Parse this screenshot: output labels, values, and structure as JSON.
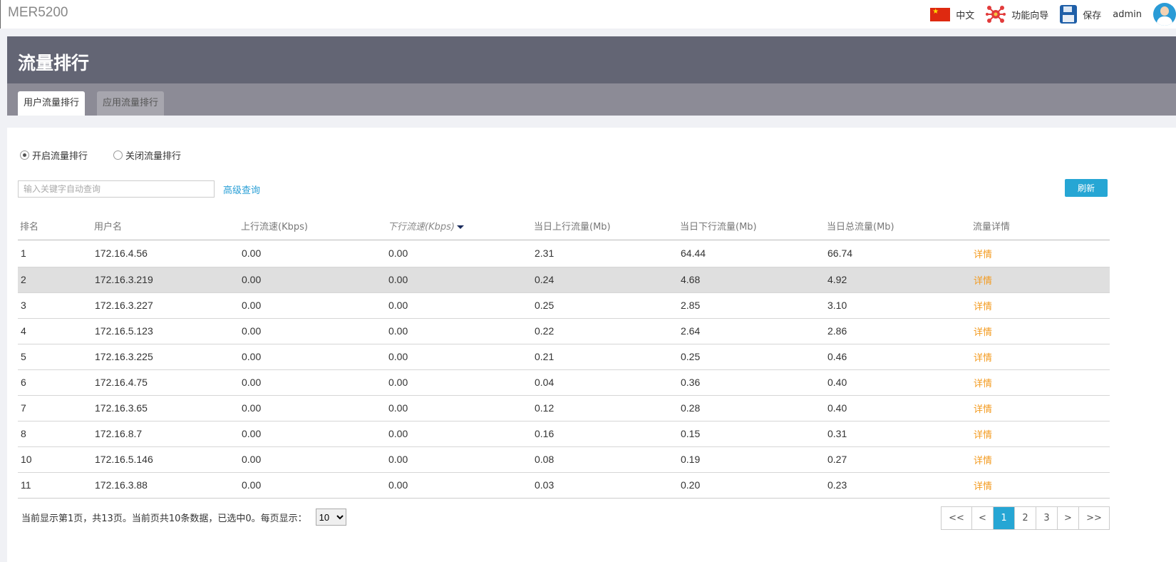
{
  "app": {
    "brand": "MER5200"
  },
  "topnav": {
    "language": "中文",
    "wizard": "功能向导",
    "save": "保存",
    "user": "admin"
  },
  "page": {
    "title": "流量排行",
    "tabs": [
      {
        "label": "用户流量排行",
        "active": true
      },
      {
        "label": "应用流量排行",
        "active": false
      }
    ]
  },
  "controls": {
    "radio_on": "开启流量排行",
    "radio_off": "关闭流量排行",
    "search_placeholder": "输入关键字自动查询",
    "advanced": "高级查询",
    "refresh": "刷新"
  },
  "table": {
    "headers": [
      "排名",
      "用户名",
      "上行流速(Kbps)",
      "下行流速(Kbps)",
      "当日上行流量(Mb)",
      "当日下行流量(Mb)",
      "当日总流量(Mb)",
      "流量详情"
    ],
    "detail_label": "详情",
    "rows": [
      [
        "1",
        "172.16.4.56",
        "0.00",
        "0.00",
        "2.31",
        "64.44",
        "66.74"
      ],
      [
        "2",
        "172.16.3.219",
        "0.00",
        "0.00",
        "0.24",
        "4.68",
        "4.92"
      ],
      [
        "3",
        "172.16.3.227",
        "0.00",
        "0.00",
        "0.25",
        "2.85",
        "3.10"
      ],
      [
        "4",
        "172.16.5.123",
        "0.00",
        "0.00",
        "0.22",
        "2.64",
        "2.86"
      ],
      [
        "5",
        "172.16.3.225",
        "0.00",
        "0.00",
        "0.21",
        "0.25",
        "0.46"
      ],
      [
        "6",
        "172.16.4.75",
        "0.00",
        "0.00",
        "0.04",
        "0.36",
        "0.40"
      ],
      [
        "7",
        "172.16.3.65",
        "0.00",
        "0.00",
        "0.12",
        "0.28",
        "0.40"
      ],
      [
        "8",
        "172.16.8.7",
        "0.00",
        "0.00",
        "0.16",
        "0.15",
        "0.31"
      ],
      [
        "10",
        "172.16.5.146",
        "0.00",
        "0.00",
        "0.08",
        "0.19",
        "0.27"
      ],
      [
        "11",
        "172.16.3.88",
        "0.00",
        "0.00",
        "0.03",
        "0.20",
        "0.23"
      ]
    ]
  },
  "footer": {
    "info": "当前显示第1页，共13页。当前页共10条数据，已选中0。每页显示：",
    "page_size": "10",
    "pager": [
      "<<",
      "<",
      "1",
      "2",
      "3",
      ">",
      ">>"
    ],
    "current_page": "1"
  },
  "colors": {
    "accent": "#26a6d4",
    "detail_link": "#f39a1e",
    "header_bg": "#636574",
    "tabbar_bg": "#8c8b96"
  }
}
